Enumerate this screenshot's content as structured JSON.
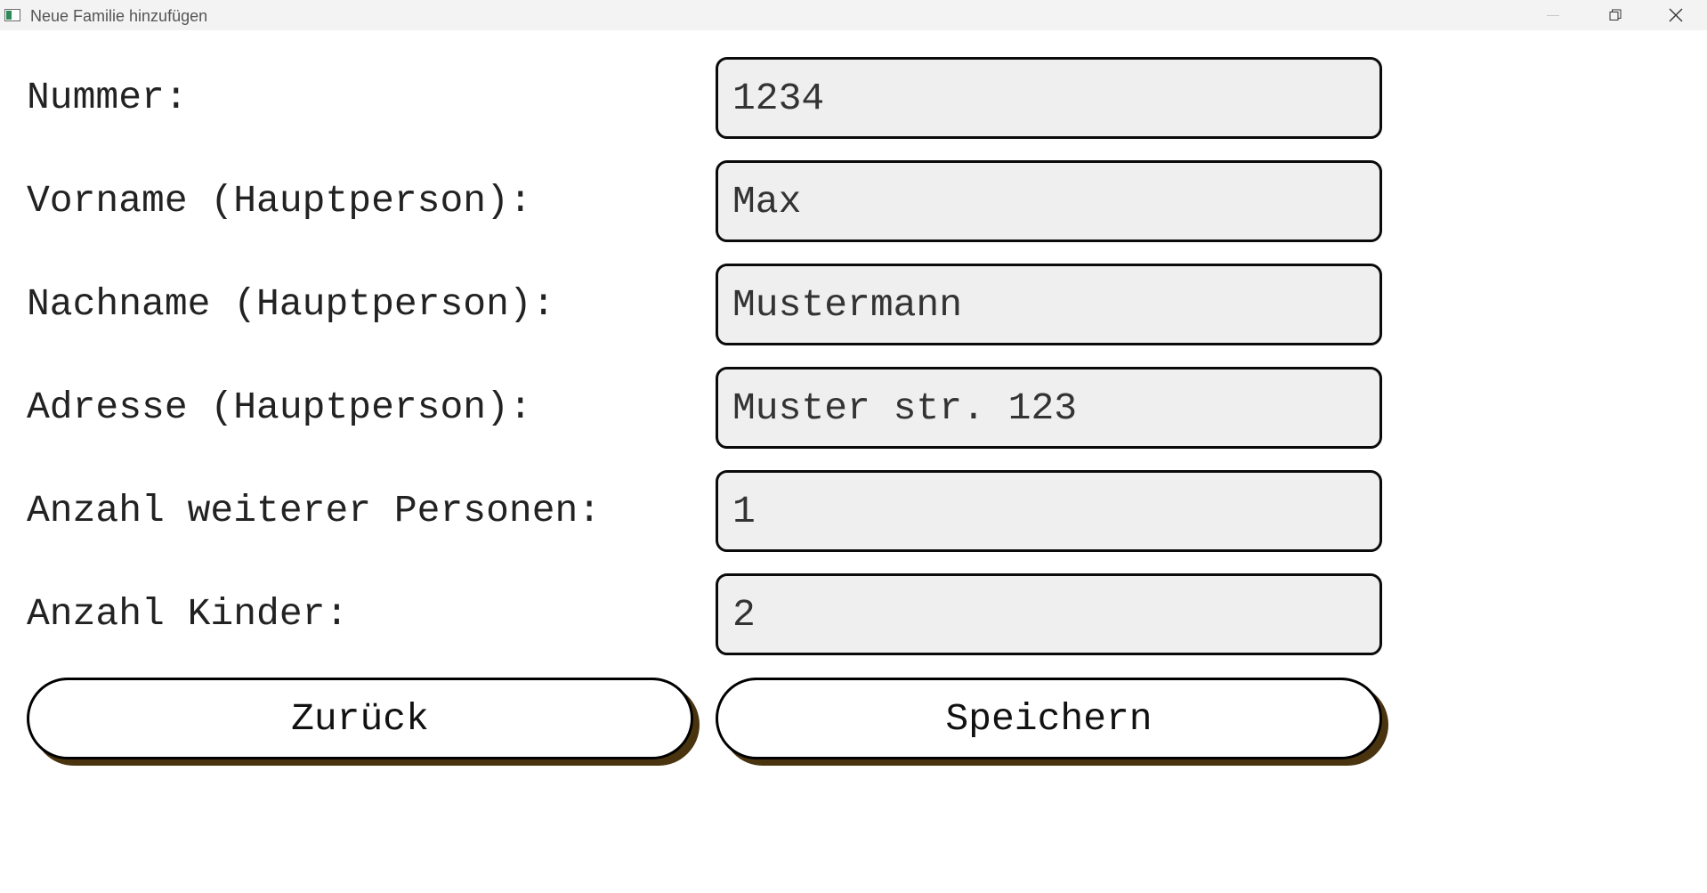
{
  "window": {
    "title": "Neue Familie hinzufügen",
    "icon": "app-window-icon",
    "controls": [
      "minimize-icon",
      "restore-icon",
      "close-icon"
    ]
  },
  "form": {
    "fields": [
      {
        "label": "Nummer:",
        "value": "1234"
      },
      {
        "label": "Vorname (Hauptperson):",
        "value": "Max"
      },
      {
        "label": "Nachname (Hauptperson):",
        "value": "Mustermann"
      },
      {
        "label": "Adresse (Hauptperson):",
        "value": "Muster str. 123"
      },
      {
        "label": "Anzahl weiterer Personen:",
        "value": "1"
      },
      {
        "label": "Anzahl Kinder:",
        "value": "2"
      }
    ]
  },
  "buttons": {
    "back_label": "Zurück",
    "save_label": "Speichern"
  },
  "colors": {
    "field_background": "#efefef",
    "button_shadow": "#4a3410",
    "titlebar": "#f3f3f3"
  }
}
